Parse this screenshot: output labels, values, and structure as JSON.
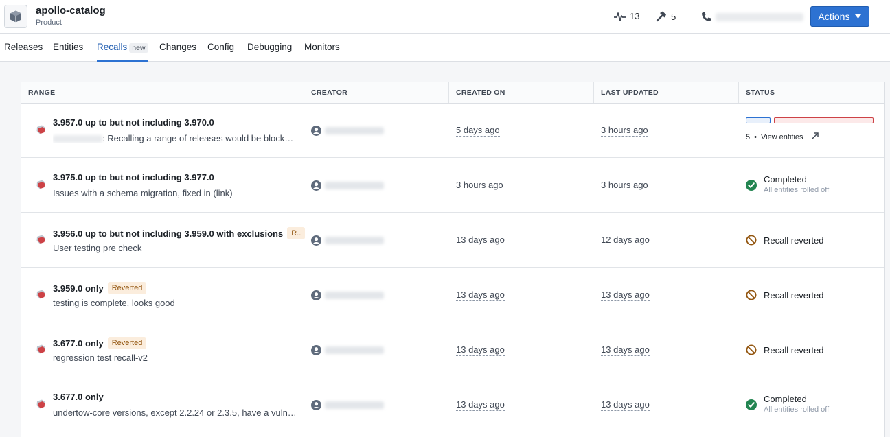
{
  "header": {
    "title": "apollo-catalog",
    "subtitle": "Product",
    "activity_count": "13",
    "build_count": "5",
    "actions_label": "Actions"
  },
  "tabs": [
    {
      "label": "Releases"
    },
    {
      "label": "Entities"
    },
    {
      "label": "Recalls",
      "tag": "new"
    },
    {
      "label": "Changes"
    },
    {
      "label": "Config"
    },
    {
      "label": "Debugging"
    },
    {
      "label": "Monitors"
    }
  ],
  "table": {
    "columns": [
      "RANGE",
      "CREATOR",
      "CREATED ON",
      "LAST UPDATED",
      "STATUS"
    ],
    "rows": [
      {
        "range": "3.957.0 up to but not including 3.970.0",
        "description": ": Recalling a range of releases would be blocke…",
        "created_on": "5 days ago",
        "last_updated": "3 hours ago",
        "status": {
          "type": "progress",
          "count": "5",
          "separator": "•",
          "link": "View entities",
          "progress_done_fraction": 0.2
        }
      },
      {
        "range": "3.975.0 up to but not including 3.977.0",
        "description": "Issues with a schema migration, fixed in (link)",
        "created_on": "3 hours ago",
        "last_updated": "3 hours ago",
        "status": {
          "type": "completed",
          "label": "Completed",
          "sub": "All entities rolled off"
        }
      },
      {
        "range": "3.956.0 up to but not including 3.959.0 with exclusions",
        "tag": "R..",
        "description": "User testing pre check",
        "created_on": "13 days ago",
        "last_updated": "12 days ago",
        "status": {
          "type": "reverted",
          "label": "Recall reverted"
        }
      },
      {
        "range": "3.959.0 only",
        "tag": "Reverted",
        "description": "testing is complete, looks good",
        "created_on": "13 days ago",
        "last_updated": "13 days ago",
        "status": {
          "type": "reverted",
          "label": "Recall reverted"
        }
      },
      {
        "range": "3.677.0 only",
        "tag": "Reverted",
        "description": "regression test recall-v2",
        "created_on": "13 days ago",
        "last_updated": "13 days ago",
        "status": {
          "type": "reverted",
          "label": "Recall reverted"
        }
      },
      {
        "range": "3.677.0 only",
        "description": "undertow-core versions, except 2.2.24 or 2.3.5, have a vuln…",
        "created_on": "13 days ago",
        "last_updated": "13 days ago",
        "status": {
          "type": "completed",
          "label": "Completed",
          "sub": "All entities rolled off"
        }
      }
    ]
  },
  "colors": {
    "accent": "#2d72d2",
    "completed": "#238551",
    "reverted": "#935610",
    "progress_done": "#2d72d2",
    "progress_pending": "#cd4246"
  }
}
